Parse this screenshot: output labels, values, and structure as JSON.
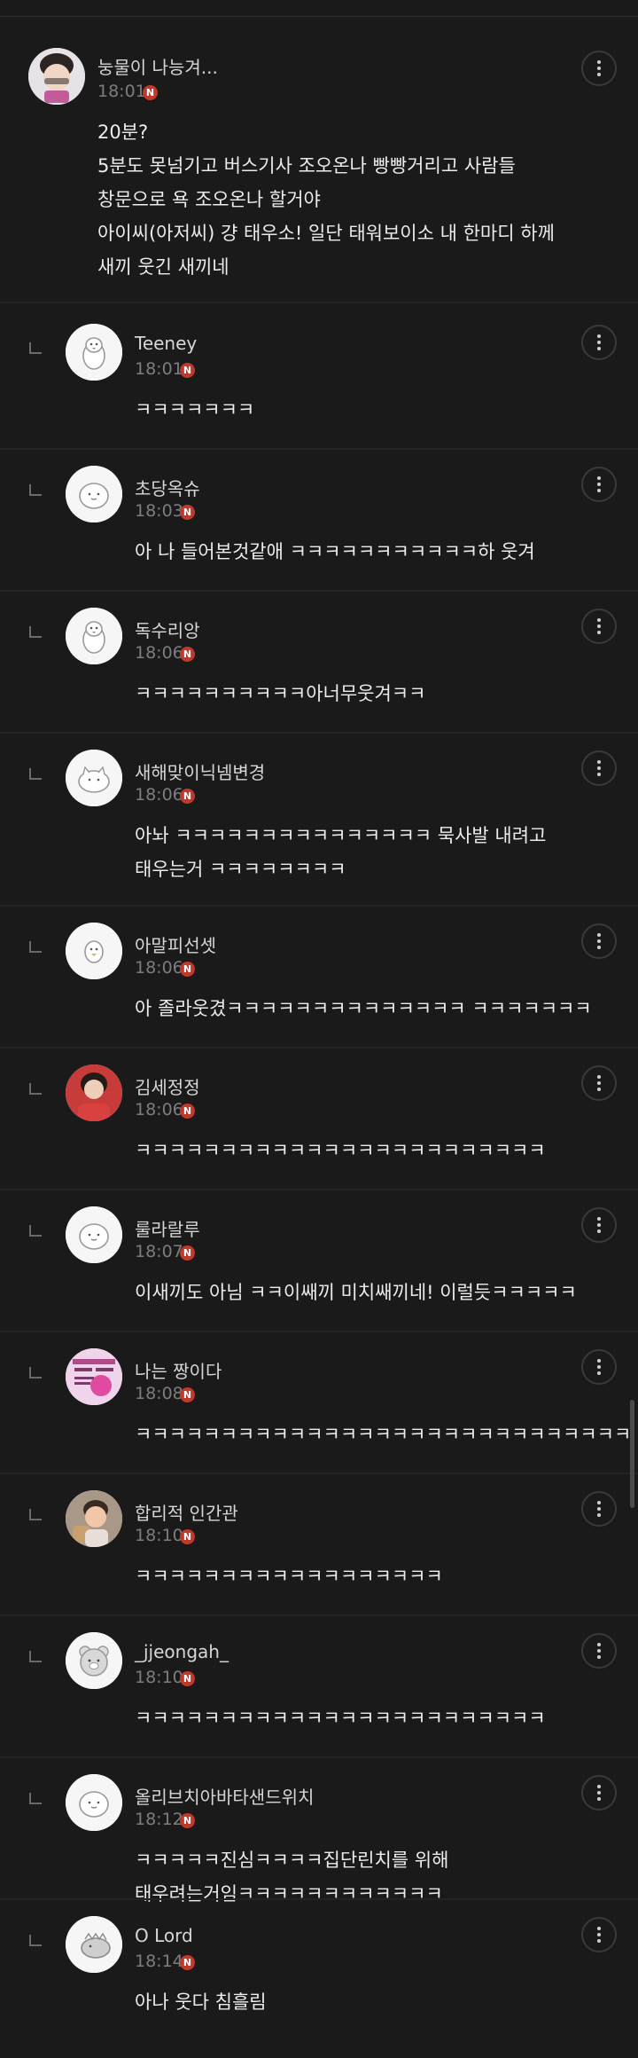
{
  "comments": [
    {
      "name": "눙물이 나능겨...",
      "time": "18:01",
      "badge": "N",
      "lines": [
        "20분?",
        "5분도 못넘기고 버스기사 조오온나 빵빵거리고 사람들",
        "창문으로 욕 조오온나 할거야",
        "아이씨(아저씨) 걍 태우소! 일단 태워보이소 내 한마디 하께",
        "새끼 웃긴 새끼네"
      ]
    },
    {
      "name": "Teeney",
      "time": "18:01",
      "badge": "N",
      "lines": [
        "ㅋㅋㅋㅋㅋㅋㅋ"
      ]
    },
    {
      "name": "초당옥슈",
      "time": "18:03",
      "badge": "N",
      "lines": [
        "아 나 들어본것같애 ㅋㅋㅋㅋㅋㅋㅋㅋㅋㅋㅋ하 웃겨"
      ]
    },
    {
      "name": "독수리앙",
      "time": "18:06",
      "badge": "N",
      "lines": [
        "ㅋㅋㅋㅋㅋㅋㅋㅋㅋㅋ아너무웃겨ㅋㅋ"
      ]
    },
    {
      "name": "새해맞이닉넴변경",
      "time": "18:06",
      "badge": "N",
      "lines": [
        "아놔 ㅋㅋㅋㅋㅋㅋㅋㅋㅋㅋㅋㅋㅋㅋㅋ 묵사발 내려고",
        "태우는거 ㅋㅋㅋㅋㅋㅋㅋㅋ"
      ]
    },
    {
      "name": "아말피선셋",
      "time": "18:06",
      "badge": "N",
      "lines": [
        "아 졸라웃겼ㅋㅋㅋㅋㅋㅋㅋㅋㅋㅋㅋㅋㅋㅋ ㅋㅋㅋㅋㅋㅋㅋ"
      ]
    },
    {
      "name": "김세정정",
      "time": "18:06",
      "badge": "N",
      "lines": [
        "ㅋㅋㅋㅋㅋㅋㅋㅋㅋㅋㅋㅋㅋㅋㅋㅋㅋㅋㅋㅋㅋㅋㅋㅋ"
      ]
    },
    {
      "name": "룰라랄루",
      "time": "18:07",
      "badge": "N",
      "lines": [
        "이새끼도 아님 ㅋㅋ이쌔끼 미치쌔끼네! 이럴듯ㅋㅋㅋㅋㅋ"
      ]
    },
    {
      "name": "나는 짱이다",
      "time": "18:08",
      "badge": "N",
      "lines": [
        "ㅋㅋㅋㅋㅋㅋㅋㅋㅋㅋㅋㅋㅋㅋㅋㅋㅋㅋㅋㅋㅋㅋㅋㅋㅋㅋㅋㅋㅋ"
      ]
    },
    {
      "name": "합리적 인간관",
      "time": "18:10",
      "badge": "N",
      "lines": [
        "ㅋㅋㅋㅋㅋㅋㅋㅋㅋㅋㅋㅋㅋㅋㅋㅋㅋㅋ"
      ]
    },
    {
      "name": "_jjeongah_",
      "time": "18:10",
      "badge": "N",
      "lines": [
        "ㅋㅋㅋㅋㅋㅋㅋㅋㅋㅋㅋㅋㅋㅋㅋㅋㅋㅋㅋㅋㅋㅋㅋㅋ"
      ]
    },
    {
      "name": "올리브치아바타샌드위치",
      "time": "18:12",
      "badge": "N",
      "lines": [
        "ㅋㅋㅋㅋㅋ진심ㅋㅋㅋㅋ집단린치를 위해",
        "태우려는거임ㅋㅋㅋㅋㅋㅋㅋㅋㅋㅋㅋㅋ"
      ]
    },
    {
      "name": "O Lord",
      "time": "18:14",
      "badge": "N",
      "lines": [
        "아나 웃다 침흘림"
      ]
    }
  ],
  "colors": {
    "background": "#1a1a1b",
    "badge": "#c0392b"
  }
}
